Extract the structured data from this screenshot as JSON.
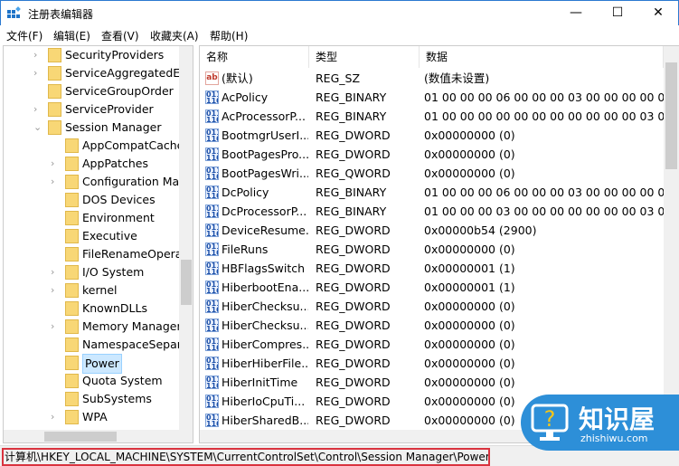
{
  "window": {
    "title": "注册表编辑器",
    "minimize": "—",
    "maximize": "☐",
    "close": "✕"
  },
  "menu": [
    "文件(F)",
    "编辑(E)",
    "查看(V)",
    "收藏夹(A)",
    "帮助(H)"
  ],
  "tree": [
    {
      "label": "SecurityProviders",
      "level": 1,
      "chevron": "›"
    },
    {
      "label": "ServiceAggregatedEv",
      "level": 1,
      "chevron": "›"
    },
    {
      "label": "ServiceGroupOrder",
      "level": 1,
      "chevron": ""
    },
    {
      "label": "ServiceProvider",
      "level": 1,
      "chevron": "›"
    },
    {
      "label": "Session Manager",
      "level": 1,
      "chevron": "⌄"
    },
    {
      "label": "AppCompatCache",
      "level": 2,
      "chevron": ""
    },
    {
      "label": "AppPatches",
      "level": 2,
      "chevron": "›"
    },
    {
      "label": "Configuration Mar",
      "level": 2,
      "chevron": "›"
    },
    {
      "label": "DOS Devices",
      "level": 2,
      "chevron": ""
    },
    {
      "label": "Environment",
      "level": 2,
      "chevron": ""
    },
    {
      "label": "Executive",
      "level": 2,
      "chevron": ""
    },
    {
      "label": "FileRenameOperat",
      "level": 2,
      "chevron": ""
    },
    {
      "label": "I/O System",
      "level": 2,
      "chevron": "›"
    },
    {
      "label": "kernel",
      "level": 2,
      "chevron": "›"
    },
    {
      "label": "KnownDLLs",
      "level": 2,
      "chevron": ""
    },
    {
      "label": "Memory Manager",
      "level": 2,
      "chevron": "›"
    },
    {
      "label": "NamespaceSepara",
      "level": 2,
      "chevron": ""
    },
    {
      "label": "Power",
      "level": 2,
      "chevron": "",
      "selected": true
    },
    {
      "label": "Quota System",
      "level": 2,
      "chevron": ""
    },
    {
      "label": "SubSystems",
      "level": 2,
      "chevron": ""
    },
    {
      "label": "WPA",
      "level": 2,
      "chevron": "›"
    }
  ],
  "columns": {
    "name": "名称",
    "type": "类型",
    "data": "数据"
  },
  "values": [
    {
      "icon": "string-value-icon",
      "name": "(默认)",
      "type": "REG_SZ",
      "data": "(数值未设置)"
    },
    {
      "icon": "binary-value-icon",
      "name": "AcPolicy",
      "type": "REG_BINARY",
      "data": "01 00 00 00 06 00 00 00 03 00 00 00 00 00 0..."
    },
    {
      "icon": "binary-value-icon",
      "name": "AcProcessorP...",
      "type": "REG_BINARY",
      "data": "01 00 00 00 00 00 00 00 00 00 00 00 03 00 0..."
    },
    {
      "icon": "binary-value-icon",
      "name": "BootmgrUserI...",
      "type": "REG_DWORD",
      "data": "0x00000000 (0)"
    },
    {
      "icon": "binary-value-icon",
      "name": "BootPagesPro...",
      "type": "REG_DWORD",
      "data": "0x00000000 (0)"
    },
    {
      "icon": "binary-value-icon",
      "name": "BootPagesWri...",
      "type": "REG_QWORD",
      "data": "0x00000000 (0)"
    },
    {
      "icon": "binary-value-icon",
      "name": "DcPolicy",
      "type": "REG_BINARY",
      "data": "01 00 00 00 06 00 00 00 03 00 00 00 00 00 0..."
    },
    {
      "icon": "binary-value-icon",
      "name": "DcProcessorP...",
      "type": "REG_BINARY",
      "data": "01 00 00 00 03 00 00 00 00 00 00 00 03 00 0..."
    },
    {
      "icon": "binary-value-icon",
      "name": "DeviceResume...",
      "type": "REG_DWORD",
      "data": "0x00000b54 (2900)"
    },
    {
      "icon": "binary-value-icon",
      "name": "FileRuns",
      "type": "REG_DWORD",
      "data": "0x00000000 (0)"
    },
    {
      "icon": "binary-value-icon",
      "name": "HBFlagsSwitch",
      "type": "REG_DWORD",
      "data": "0x00000001 (1)"
    },
    {
      "icon": "binary-value-icon",
      "name": "HiberbootEna...",
      "type": "REG_DWORD",
      "data": "0x00000001 (1)"
    },
    {
      "icon": "binary-value-icon",
      "name": "HiberChecksu...",
      "type": "REG_DWORD",
      "data": "0x00000000 (0)"
    },
    {
      "icon": "binary-value-icon",
      "name": "HiberChecksu...",
      "type": "REG_DWORD",
      "data": "0x00000000 (0)"
    },
    {
      "icon": "binary-value-icon",
      "name": "HiberCompres...",
      "type": "REG_DWORD",
      "data": "0x00000000 (0)"
    },
    {
      "icon": "binary-value-icon",
      "name": "HiberHiberFile...",
      "type": "REG_DWORD",
      "data": "0x00000000 (0)"
    },
    {
      "icon": "binary-value-icon",
      "name": "HiberInitTime",
      "type": "REG_DWORD",
      "data": "0x00000000 (0)"
    },
    {
      "icon": "binary-value-icon",
      "name": "HiberIoCpuTi...",
      "type": "REG_DWORD",
      "data": "0x00000000 (0)"
    },
    {
      "icon": "binary-value-icon",
      "name": "HiberSharedB...",
      "type": "REG_DWORD",
      "data": "0x00000000 (0)"
    }
  ],
  "status": {
    "path": "计算机\\HKEY_LOCAL_MACHINE\\SYSTEM\\CurrentControlSet\\Control\\Session Manager\\Power"
  },
  "watermark": {
    "brand": "知识屋",
    "site": "zhishiwu.com"
  },
  "colors": {
    "highlight": "#d9333f",
    "watermark": "#2d8fd8",
    "selection": "#cce8ff"
  }
}
